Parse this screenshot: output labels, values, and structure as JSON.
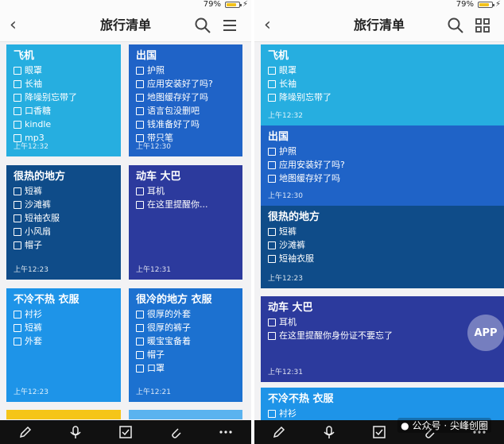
{
  "status": {
    "battery": "79%"
  },
  "left_screen": {
    "title": "旅行清单",
    "cards": [
      {
        "title": "飞机",
        "items": [
          "眼罩",
          "长袖",
          "降噪别忘带了",
          "口香糖",
          "kindle",
          "mp3"
        ],
        "time": "上午12:32",
        "color": "#26aee0"
      },
      {
        "title": "出国",
        "items": [
          "护照",
          "应用安装好了吗?",
          "地图缓存好了吗",
          "语言包没删吧",
          "钱准备好了吗",
          "带只笔"
        ],
        "time": "上午12:30",
        "color": "#1f63c7"
      },
      {
        "title": "很热的地方",
        "items": [
          "短裤",
          "沙滩裤",
          "短袖衣服",
          "小风扇",
          "帽子"
        ],
        "time": "上午12:23",
        "color": "#0f4c89"
      },
      {
        "title": "动车 大巴",
        "items": [
          "耳机",
          "在这里提醒你..."
        ],
        "time": "上午12:31",
        "color": "#2c3a9d"
      },
      {
        "title": "不冷不热  衣服",
        "items": [
          "衬衫",
          "短裤",
          "外套"
        ],
        "time": "上午12:23",
        "color": "#1e94e8"
      },
      {
        "title": "很冷的地方  衣服",
        "items": [
          "很厚的外套",
          "很厚的裤子",
          "暖宝宝备着",
          "帽子",
          "口罩"
        ],
        "time": "上午12:21",
        "color": "#1c71d0"
      }
    ]
  },
  "right_screen": {
    "title": "旅行清单",
    "cards": [
      {
        "title": "飞机",
        "items": [
          "眼罩",
          "长袖",
          "降噪别忘带了"
        ],
        "time": "上午12:32",
        "color": "#26aee0"
      },
      {
        "title": "出国",
        "items": [
          "护照",
          "应用安装好了吗?",
          "地图缓存好了吗"
        ],
        "time": "上午12:30",
        "color": "#1f63c7"
      },
      {
        "title": "很热的地方",
        "items": [
          "短裤",
          "沙滩裤",
          "短袖衣服"
        ],
        "time": "上午12:23",
        "color": "#0f4c89"
      },
      {
        "title": "动车 大巴",
        "items": [
          "耳机",
          "在这里提醒你身份证不要忘了"
        ],
        "time": "上午12:31",
        "color": "#2c3a9d"
      },
      {
        "title": "不冷不热  衣服",
        "items": [
          "衬衫"
        ],
        "time": "",
        "color": "#1e94e8"
      }
    ]
  },
  "watermark": {
    "text": "公众号 · 尖峰创圈"
  },
  "badge": {
    "text": "APP"
  }
}
